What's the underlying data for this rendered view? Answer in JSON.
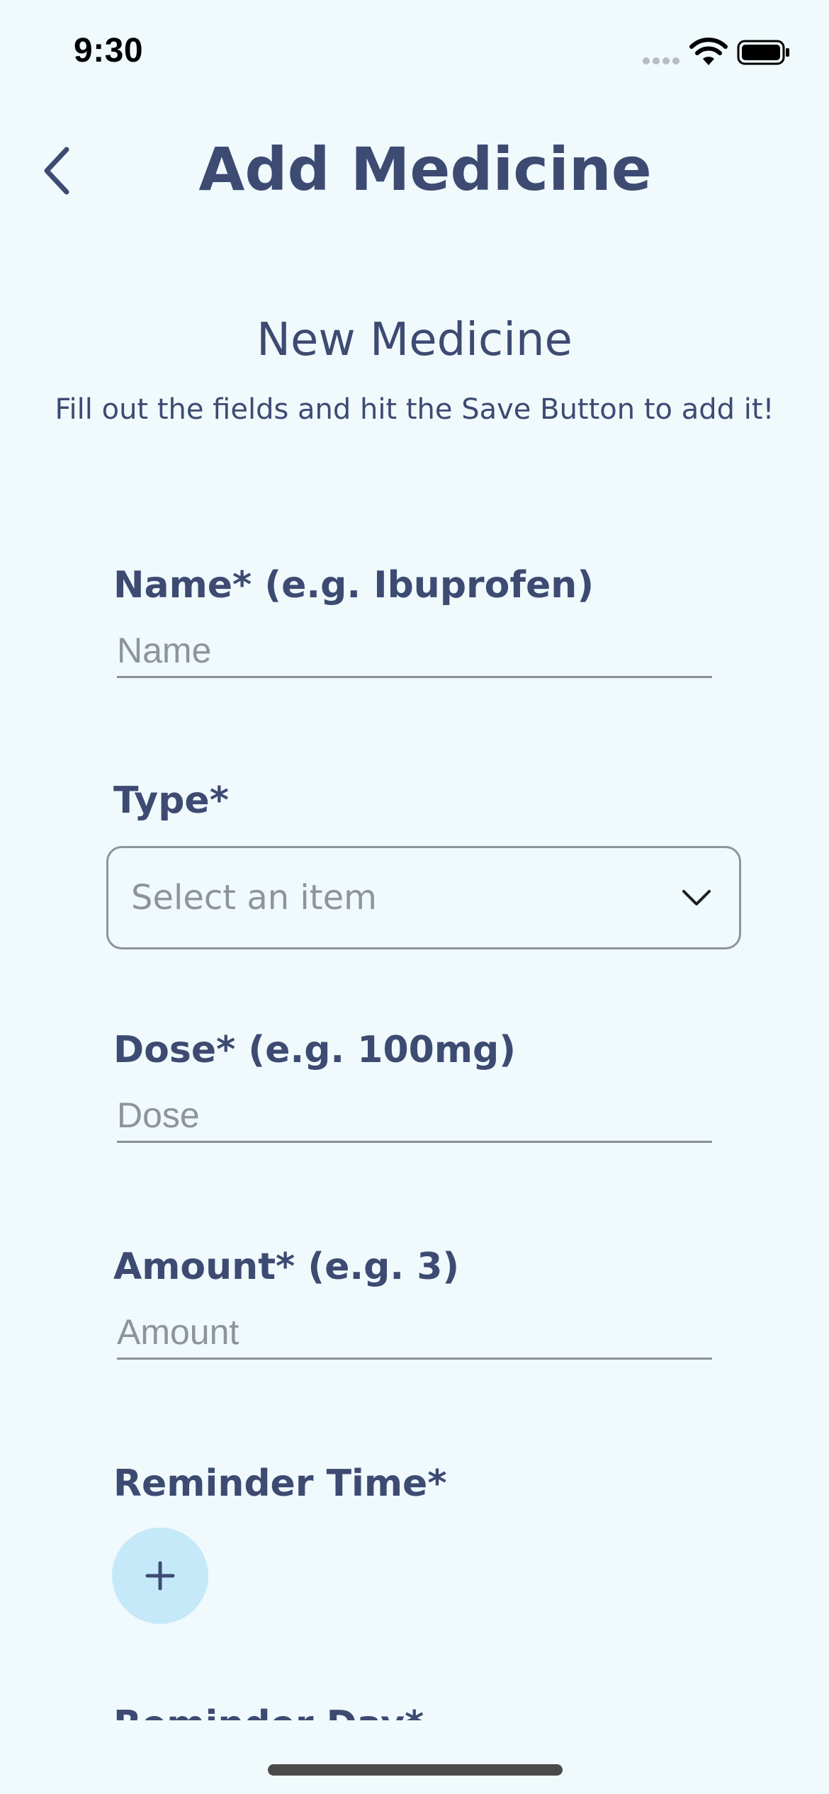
{
  "status_bar": {
    "time": "9:30"
  },
  "header": {
    "title": "Add Medicine",
    "back_icon": "chevron-left-icon"
  },
  "section": {
    "title": "New Medicine",
    "subtitle": "Fill out the fields and hit the Save Button to add it!"
  },
  "fields": {
    "name": {
      "label": "Name* (e.g. Ibuprofen)",
      "placeholder": "Name",
      "value": ""
    },
    "type": {
      "label": "Type*",
      "placeholder": "Select an item"
    },
    "dose": {
      "label": "Dose* (e.g. 100mg)",
      "placeholder": "Dose",
      "value": ""
    },
    "amount": {
      "label": "Amount* (e.g. 3)",
      "placeholder": "Amount",
      "value": ""
    },
    "reminder_time": {
      "label": "Reminder Time*",
      "add_icon": "plus-icon"
    },
    "reminder_day": {
      "label": "Reminder Day*"
    }
  },
  "colors": {
    "background": "#f0f9fc",
    "text_primary": "#3d4b72",
    "placeholder": "#8e949b",
    "add_button_bg": "#c5e9f9"
  }
}
